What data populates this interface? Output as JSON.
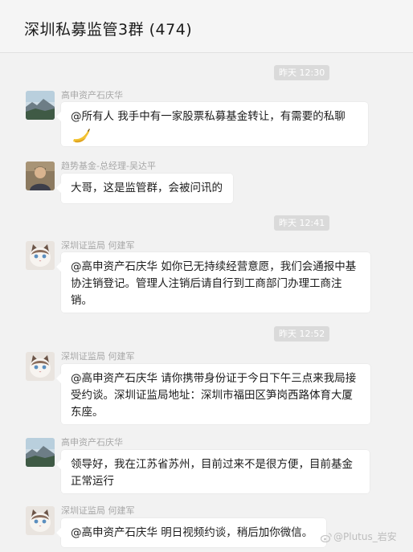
{
  "header": {
    "title": "深圳私募监管3群 (474)"
  },
  "timestamps": [
    "昨天 12:30",
    "昨天 12:41",
    "昨天 12:52"
  ],
  "messages": [
    {
      "sender": "高申资产石庆华",
      "text": "@所有人   我手中有一家股票私募基金转让，有需要的私聊",
      "emoji": "banana-emoji"
    },
    {
      "sender": "趋势基金-总经理-吴达平",
      "text": "大哥，这是监管群，会被问讯的"
    },
    {
      "sender": "深圳证监局 何建军",
      "text": "@高申资产石庆华 如你已无持续经营意愿，我们会通报中基协注销登记。管理人注销后请自行到工商部门办理工商注销。"
    },
    {
      "sender": "深圳证监局 何建军",
      "text": "@高申资产石庆华 请你携带身份证于今日下午三点来我局接受约谈。深圳证监局地址：深圳市福田区笋岗西路体育大厦东座。"
    },
    {
      "sender": "高申资产石庆华",
      "text": "领导好，我在江苏省苏州，目前过来不是很方便，目前基金正常运行"
    },
    {
      "sender": "深圳证监局 何建军",
      "text": "@高申资产石庆华 明日视频约谈，稍后加你微信。"
    }
  ],
  "watermark": {
    "text": "@Plutus_岩安"
  },
  "colors": {
    "background": "#f2f2f2",
    "bubble": "#ffffff",
    "timestamp_bg": "#dadada",
    "sender": "#a7a7a7"
  }
}
